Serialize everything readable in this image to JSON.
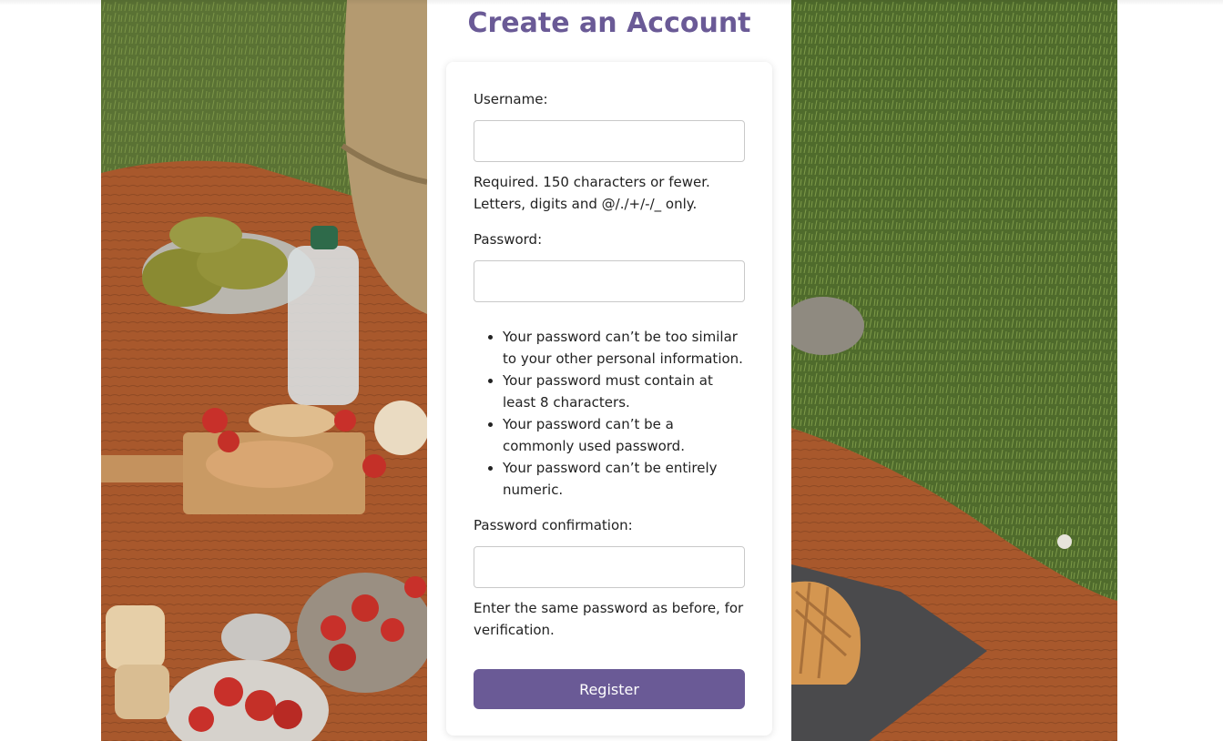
{
  "page": {
    "title": "Create an Account"
  },
  "form": {
    "username_label": "Username:",
    "username_value": "",
    "username_help": "Required. 150 characters or fewer. Letters, digits and @/./+/-/_ only.",
    "password_label": "Password:",
    "password_value": "",
    "password_rules": [
      "Your password can’t be too similar to your other personal information.",
      "Your password must contain at least 8 characters.",
      "Your password can’t be a commonly used password.",
      "Your password can’t be entirely numeric."
    ],
    "confirm_label": "Password confirmation:",
    "confirm_value": "",
    "confirm_help": "Enter the same password as before, for verification.",
    "register_label": "Register"
  },
  "colors": {
    "accent": "#6a5a96",
    "background": "#ffffff",
    "blanket": "#a8582c",
    "grass": "#4f6b2c"
  },
  "images": {
    "left_photo": "picnic-blanket-food-photo",
    "right_photo": "picnic-blanket-grass-photo"
  }
}
